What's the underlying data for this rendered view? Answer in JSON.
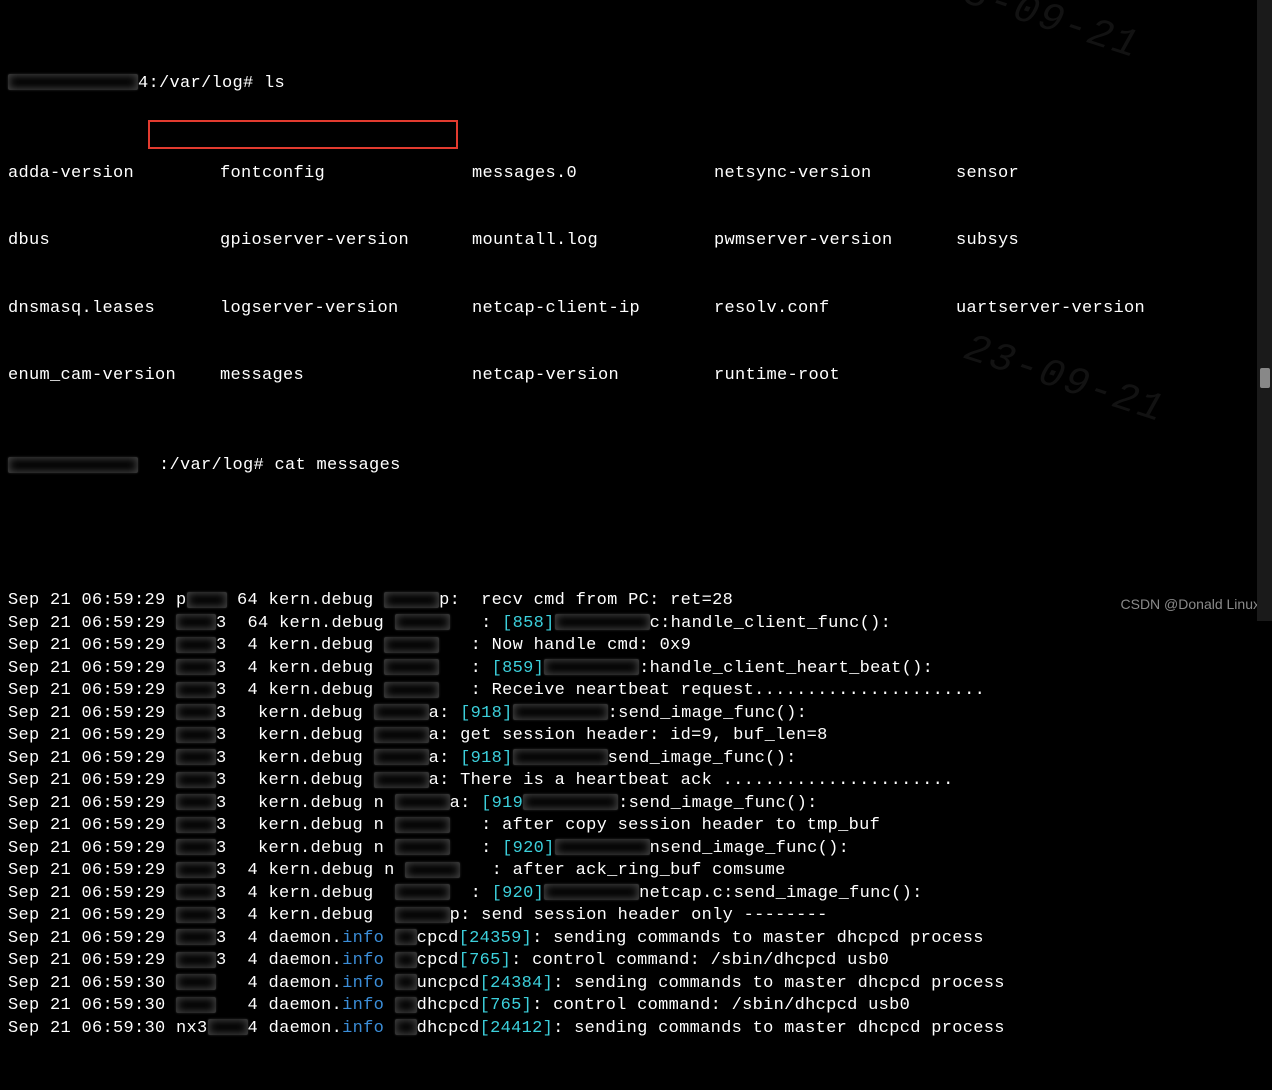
{
  "prompt1_host_suffix": "4",
  "prompt1_path": ":/var/log# ",
  "prompt1_cmd": "ls",
  "ls_files": {
    "row1": [
      "adda-version",
      "fontconfig",
      "messages.0",
      "netsync-version",
      "sensor"
    ],
    "row2": [
      "dbus",
      "gpioserver-version",
      "mountall.log",
      "pwmserver-version",
      "subsys"
    ],
    "row3": [
      "dnsmasq.leases",
      "logserver-version",
      "netcap-client-ip",
      "resolv.conf",
      "uartserver-version"
    ],
    "row4": [
      "enum_cam-version",
      "messages",
      "netcap-version",
      "runtime-root",
      ""
    ]
  },
  "prompt2_path": ":/var/log# ",
  "prompt2_cmd": "cat messages",
  "loglines": [
    {
      "pre": "Sep 21 06:59:29 p",
      "g": " 64",
      "facility": "kern.debug",
      "g2": "p:",
      "msg": " recv cmd from PC: ret=28"
    },
    {
      "pre": "Sep 21 06:59:29 ",
      "g": "3  64",
      "facility": "kern.debug",
      "g2": "   :",
      "pid": "[858]",
      "tail": "c:handle_client_func():"
    },
    {
      "pre": "Sep 21 06:59:29 ",
      "g": "3  4",
      "facility": "kern.debug",
      "g2": "   :",
      "msg": "Now handle cmd: 0x9"
    },
    {
      "pre": "Sep 21 06:59:29 ",
      "g": "3  4",
      "facility": "kern.debug",
      "g2": "   :",
      "pid": "[859]",
      "tail": ":handle_client_heart_beat():"
    },
    {
      "pre": "Sep 21 06:59:29 ",
      "g": "3  4",
      "facility": "kern.debug",
      "g2": "   :",
      "msg": "Receive neartbeat request......................"
    },
    {
      "pre": "Sep 21 06:59:29 ",
      "g": "3  ",
      "facility": "kern.debug",
      "g2": "a:",
      "pid": "[918]",
      "tail": ":send_image_func():"
    },
    {
      "pre": "Sep 21 06:59:29 ",
      "g": "3  ",
      "facility": "kern.debug",
      "g2": "a:",
      "msg": "get session header: id=9, buf_len=8"
    },
    {
      "pre": "Sep 21 06:59:29 ",
      "g": "3  ",
      "facility": "kern.debug",
      "g2": "a:",
      "pid": "[918]",
      "tail": "send_image_func():"
    },
    {
      "pre": "Sep 21 06:59:29 ",
      "g": "3  ",
      "facility": "kern.debug",
      "g2": "a:",
      "msg": "There is a heartbeat ack ......................"
    },
    {
      "pre": "Sep 21 06:59:29 ",
      "g": "3  ",
      "facility": "kern.debug n",
      "g2": "a:",
      "pid": "[919",
      "tail": ":send_image_func():"
    },
    {
      "pre": "Sep 21 06:59:29 ",
      "g": "3  ",
      "facility": "kern.debug n",
      "g2": "   :",
      "msg": "after copy session header to tmp_buf"
    },
    {
      "pre": "Sep 21 06:59:29 ",
      "g": "3  ",
      "facility": "kern.debug n",
      "g2": "   :",
      "pid": "[920]",
      "tail": "send_image_func():",
      "mid": "n"
    },
    {
      "pre": "Sep 21 06:59:29 ",
      "g": "3  4",
      "facility": "kern.debug n",
      "g2": "   :",
      "msg": "after ack_ring_buf comsume"
    },
    {
      "pre": "Sep 21 06:59:29 ",
      "g": "3  4",
      "facility": "kern.debug ",
      "g2": "  :",
      "pid": "[920]",
      "tail": "netcap.c:send_image_func():"
    },
    {
      "pre": "Sep 21 06:59:29 ",
      "g": "3  4",
      "facility": "kern.debug ",
      "g2": "p:",
      "msg": "send session header only --------"
    },
    {
      "pre": "Sep 21 06:59:29 ",
      "g": "3  4",
      "facility": "daemon.",
      "info": "info",
      "proc": "cpcd",
      "pid": "[24359]",
      "tail": ": sending commands to master dhcpcd process"
    },
    {
      "pre": "Sep 21 06:59:29 ",
      "g": "3  4",
      "facility": "daemon.",
      "info": "info",
      "proc": "cpcd",
      "pid": "[765]",
      "tail": ": control command: /sbin/dhcpcd usb0"
    },
    {
      "pre": "Sep 21 06:59:30 ",
      "g": "   4",
      "facility": "daemon.",
      "info": "info",
      "proc": "uncpcd",
      "pid": "[24384]",
      "tail": ": sending commands to master dhcpcd process"
    },
    {
      "pre": "Sep 21 06:59:30 ",
      "g": "   4",
      "facility": "daemon.",
      "info": "info",
      "proc": "dhcpcd",
      "pid": "[765]",
      "tail": ": control command: /sbin/dhcpcd usb0"
    },
    {
      "pre": "Sep 21 06:59:30 nx3",
      "g": "4",
      "facility": "daemon.",
      "info": "info",
      "proc": "dhcpcd",
      "pid": "[24412]",
      "tail": ": sending commands to master dhcpcd process"
    }
  ],
  "watermark": "CSDN @Donald Linux"
}
